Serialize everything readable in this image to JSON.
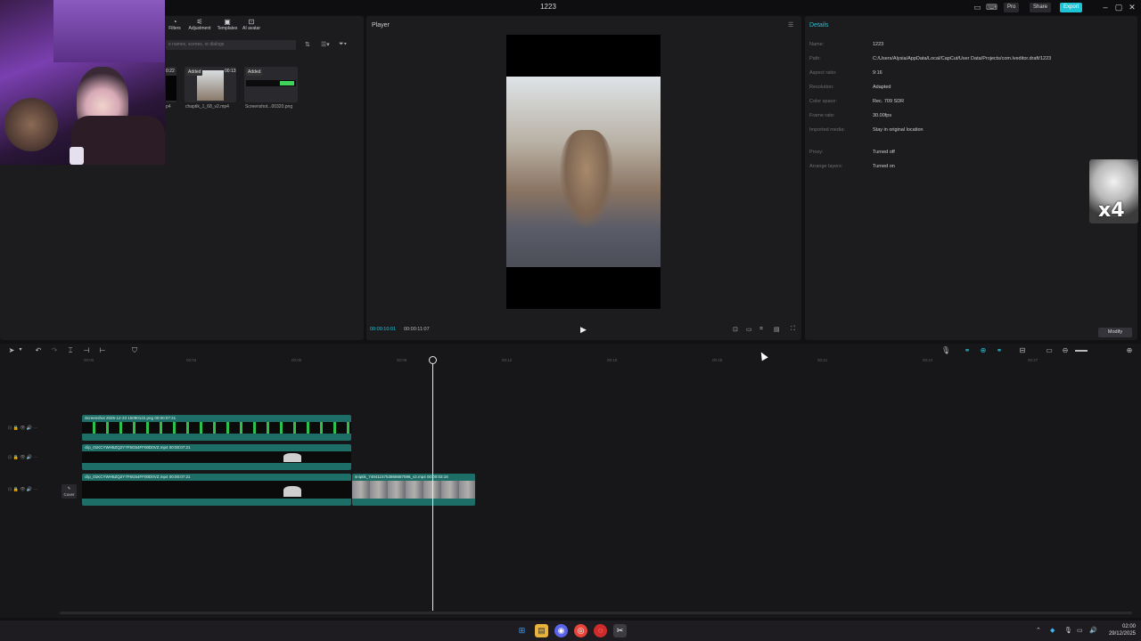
{
  "window": {
    "title": "1223",
    "pro_label": "Pro",
    "share_label": "Share",
    "export_label": "Export"
  },
  "media": {
    "tabs": [
      {
        "label": "Filters",
        "icon": "filters-icon"
      },
      {
        "label": "Adjustment",
        "icon": "adjustment-icon"
      },
      {
        "label": "Templates",
        "icon": "templates-icon"
      },
      {
        "label": "AI avatar",
        "icon": "ai-avatar-icon"
      }
    ],
    "search_placeholder": "e names, scenes, or dialogs",
    "items": [
      {
        "badge": "0:22",
        "name": "p4"
      },
      {
        "badge": "Added",
        "duration": "00:13",
        "name": "chaptik_1_68_v2.mp4"
      },
      {
        "badge": "Added",
        "name": "Screenshot...00320.png"
      }
    ]
  },
  "player": {
    "title": "Player",
    "current_time": "00:00:10:01",
    "total_time": "00:00:11:07"
  },
  "details": {
    "title": "Details",
    "rows": [
      {
        "key": "Name:",
        "value": "1223"
      },
      {
        "key": "Path:",
        "value": "C:/Users/Alysia/AppData/Local/CapCut/User Data/Projects/com.lveditor.draft/1223"
      },
      {
        "key": "Aspect ratio:",
        "value": "9:16"
      },
      {
        "key": "Resolution:",
        "value": "Adapted"
      },
      {
        "key": "Color space:",
        "value": "Rec. 709 SDR"
      },
      {
        "key": "Frame rate:",
        "value": "30.00fps"
      },
      {
        "key": "Imported media:",
        "value": "Stay in original location"
      },
      {
        "key": "Proxy:",
        "value": "Turned off"
      },
      {
        "key": "Arrange layers:",
        "value": "Turned on"
      }
    ],
    "modify_label": "Modify"
  },
  "sticker_text": "x4",
  "timeline": {
    "ruler": [
      "00:00",
      "00:03",
      "00:06",
      "00:09",
      "00:12",
      "00:15",
      "00:18",
      "00:21",
      "00:24",
      "00:27"
    ],
    "cover_label": "Cover",
    "clips": [
      {
        "label": "Screenshot 2025-12-23 15090122.png  00:00:07:21"
      },
      {
        "label": "clip_01KCYWH5ZQ2Y7F6G54FF00D0VZ.mp4  00:00:07:21"
      },
      {
        "label": "clip_01KCYWH5ZQ2Y7F6G54FF00D0VZ.mp4  00:00:07:21"
      },
      {
        "label": "sniptik_7494115753868687596_v2.mp4  00:00:03:16"
      }
    ]
  },
  "taskbar": {
    "time": "02:00",
    "date": "29/12/2025"
  }
}
